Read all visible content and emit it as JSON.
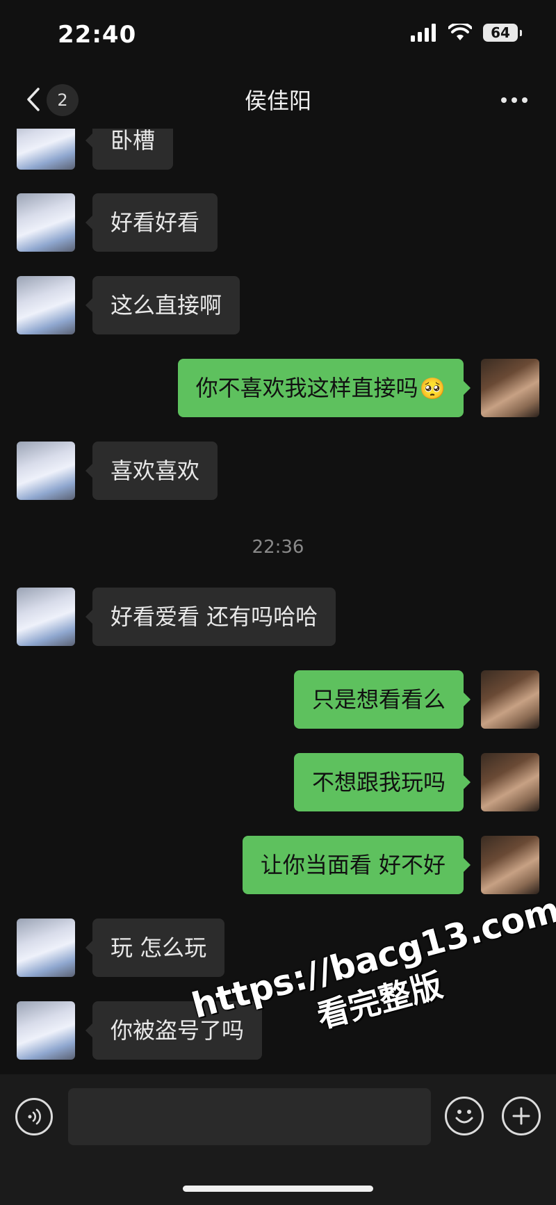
{
  "status_bar": {
    "time": "22:40",
    "battery": "64"
  },
  "header": {
    "title": "侯佳阳",
    "unread_count": "2"
  },
  "messages": [
    {
      "side": "in",
      "text": "卧槽"
    },
    {
      "side": "in",
      "text": "好看好看"
    },
    {
      "side": "in",
      "text": "这么直接啊"
    },
    {
      "side": "out",
      "text": "你不喜欢我这样直接吗",
      "emoji": "🥺"
    },
    {
      "side": "in",
      "text": "喜欢喜欢"
    },
    {
      "type": "timestamp",
      "text": "22:36"
    },
    {
      "side": "in",
      "text": "好看爱看 还有吗哈哈"
    },
    {
      "side": "out",
      "text": "只是想看看么"
    },
    {
      "side": "out",
      "text": "不想跟我玩吗"
    },
    {
      "side": "out",
      "text": "让你当面看 好不好"
    },
    {
      "side": "in",
      "text": "玩 怎么玩"
    },
    {
      "side": "in",
      "text": "你被盗号了吗"
    }
  ],
  "input": {
    "value": ""
  },
  "watermark": {
    "url": "https://bacg13.com",
    "sub": "看完整版"
  },
  "colors": {
    "outgoing_bubble": "#5ec15e",
    "incoming_bubble": "#2c2c2c",
    "background": "#111111"
  },
  "icons": [
    "signal-icon",
    "wifi-icon",
    "battery-icon",
    "back-chevron-icon",
    "more-dots-icon",
    "voice-icon",
    "emoji-icon",
    "add-icon"
  ]
}
